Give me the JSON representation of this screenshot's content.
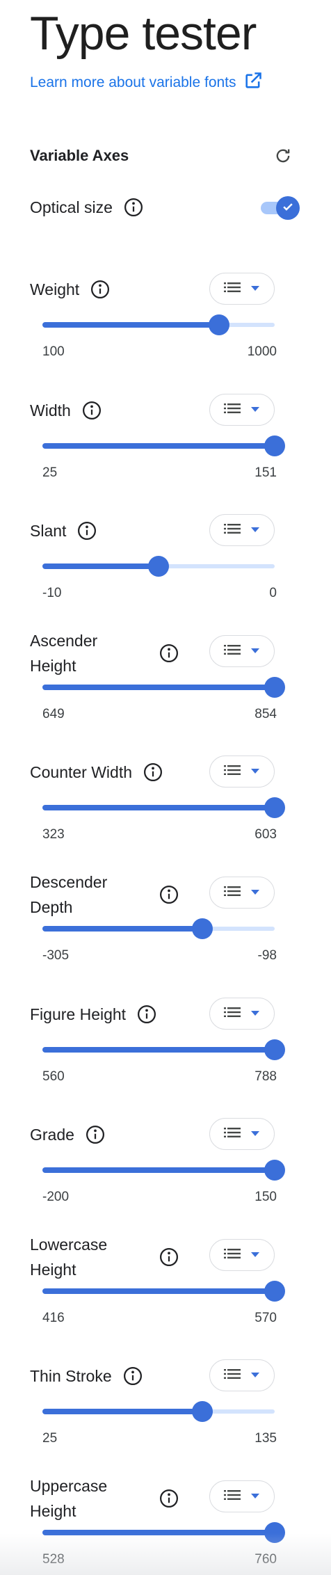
{
  "page_title": "Type tester",
  "learn_link": "Learn more about variable fonts",
  "axes_title": "Variable Axes",
  "optical_size": {
    "label": "Optical size",
    "enabled": true
  },
  "axes": [
    {
      "label": "Weight",
      "min": "100",
      "max": "1000",
      "value": 0.76
    },
    {
      "label": "Width",
      "min": "25",
      "max": "151",
      "value": 1.0
    },
    {
      "label": "Slant",
      "min": "-10",
      "max": "0",
      "value": 0.5
    },
    {
      "label": "Ascender Height",
      "min": "649",
      "max": "854",
      "value": 1.0
    },
    {
      "label": "Counter Width",
      "min": "323",
      "max": "603",
      "value": 1.0
    },
    {
      "label": "Descender Depth",
      "min": "-305",
      "max": "-98",
      "value": 0.69
    },
    {
      "label": "Figure Height",
      "min": "560",
      "max": "788",
      "value": 1.0
    },
    {
      "label": "Grade",
      "min": "-200",
      "max": "150",
      "value": 1.0
    },
    {
      "label": "Lowercase Height",
      "min": "416",
      "max": "570",
      "value": 1.0
    },
    {
      "label": "Thin Stroke",
      "min": "25",
      "max": "135",
      "value": 0.69
    },
    {
      "label": "Uppercase Height",
      "min": "528",
      "max": "760",
      "value": 1.0
    }
  ],
  "colors": {
    "accent": "#3b6fd9",
    "track": "#d3e3fd",
    "link": "#1a73e8"
  },
  "icons": {
    "external_link": "external-link-icon",
    "reset": "reset-icon",
    "info": "info-icon",
    "list": "list-icon",
    "dropdown": "caret-down-icon",
    "check": "check-icon"
  }
}
